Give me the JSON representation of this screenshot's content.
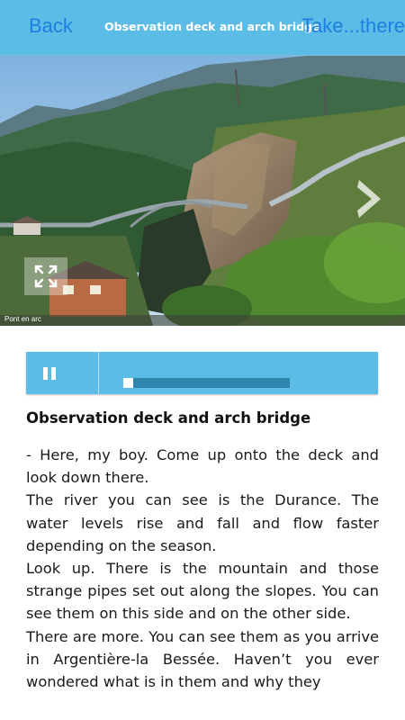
{
  "navbar": {
    "back_label": "Back",
    "title": "Observation deck and arch bridge",
    "action_label": "Take...there",
    "background_color": "#5bbde6",
    "link_color": "#1f7fe0"
  },
  "photo": {
    "caption": "Pont en arc",
    "expand_icon": "expand-arrows-icon",
    "next_icon": "chevron-right-icon"
  },
  "player": {
    "pause_icon": "pause-icon",
    "progress_fraction": 0.06,
    "background_color": "#5bbde6"
  },
  "article": {
    "title": "Observation deck and arch bridge",
    "paragraphs": [
      "- Here, my boy. Come up onto the deck and look down there.",
      "The river you can see is the Durance. The water levels rise and fall and flow faster depending on the season.",
      "Look up. There is the mountain and those strange pipes set out along the slopes. You can see them on this side and on the other side.",
      "There are more. You can see them as you arrive in Argentière-la Bessée. Haven’t you ever wondered what is in them and why they"
    ]
  }
}
